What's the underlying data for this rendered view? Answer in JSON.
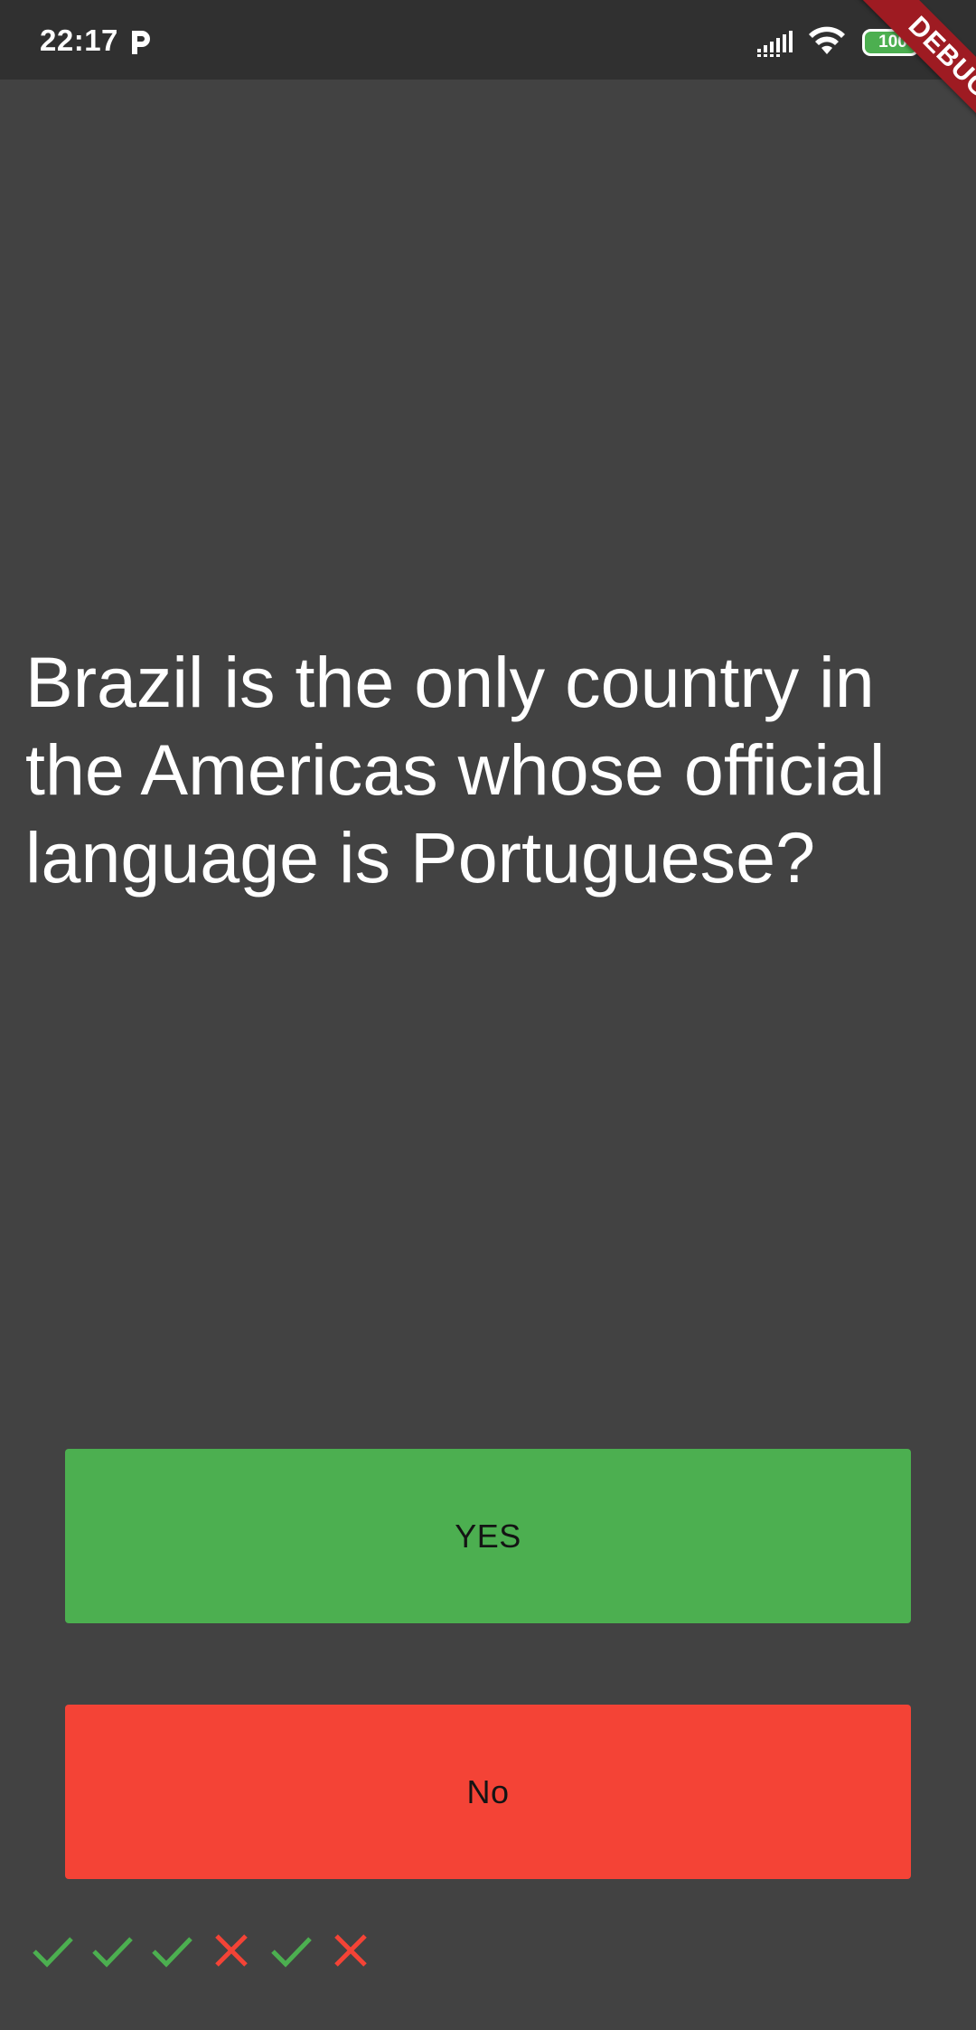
{
  "status_bar": {
    "time": "22:17",
    "battery": "100"
  },
  "debug_banner": {
    "label": "DEBUG"
  },
  "question": {
    "text": "Brazil is the only country in the Americas whose official language is Portuguese?"
  },
  "buttons": {
    "yes_label": "YES",
    "no_label": "No"
  },
  "score_keeper": {
    "marks": [
      "check-icon",
      "check-icon",
      "check-icon",
      "close-icon",
      "check-icon",
      "close-icon"
    ]
  },
  "colors": {
    "background": "#424242",
    "status_bar": "#303030",
    "yes": "#4caf50",
    "no": "#f44336",
    "check": "#4caf50",
    "cross": "#f44336",
    "debug_banner": "#9e1b22"
  }
}
